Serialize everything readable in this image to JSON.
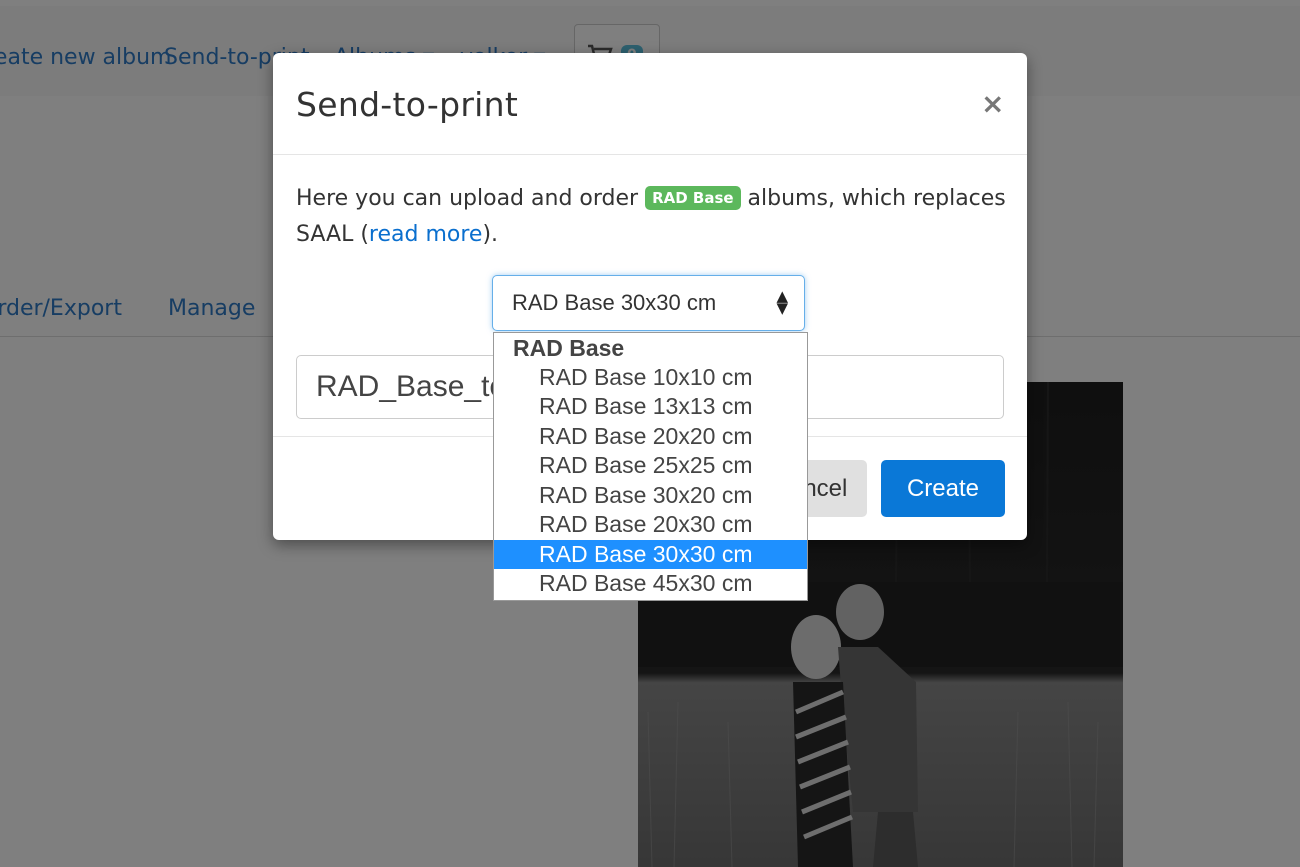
{
  "navbar": {
    "items": [
      "Create new album",
      "Send-to-print",
      "Albums ▾",
      "volker ▾"
    ],
    "cart_count": "0"
  },
  "tabs": [
    "Order/Export",
    "Manage"
  ],
  "modal": {
    "title": "Send-to-print",
    "close_label": "×",
    "intro_before": "Here you can upload and order ",
    "badge": "RAD Base",
    "intro_after": " albums, which replaces SAAL (",
    "link": "read more",
    "intro_end": ").",
    "select_value": "RAD Base 30x30 cm",
    "name_value": "RAD_Base_te",
    "cancel_label": "Cancel",
    "create_label": "Create"
  },
  "dropdown": {
    "group": "RAD Base",
    "options": [
      "RAD Base 10x10 cm",
      "RAD Base 13x13 cm",
      "RAD Base 20x20 cm",
      "RAD Base 25x25 cm",
      "RAD Base 30x20 cm",
      "RAD Base 20x30 cm",
      "RAD Base 30x30 cm",
      "RAD Base 45x30 cm"
    ],
    "selected_index": 6
  },
  "colors": {
    "accent": "#0a78d7",
    "badge": "#5cb85c",
    "selection": "#1e90ff"
  }
}
